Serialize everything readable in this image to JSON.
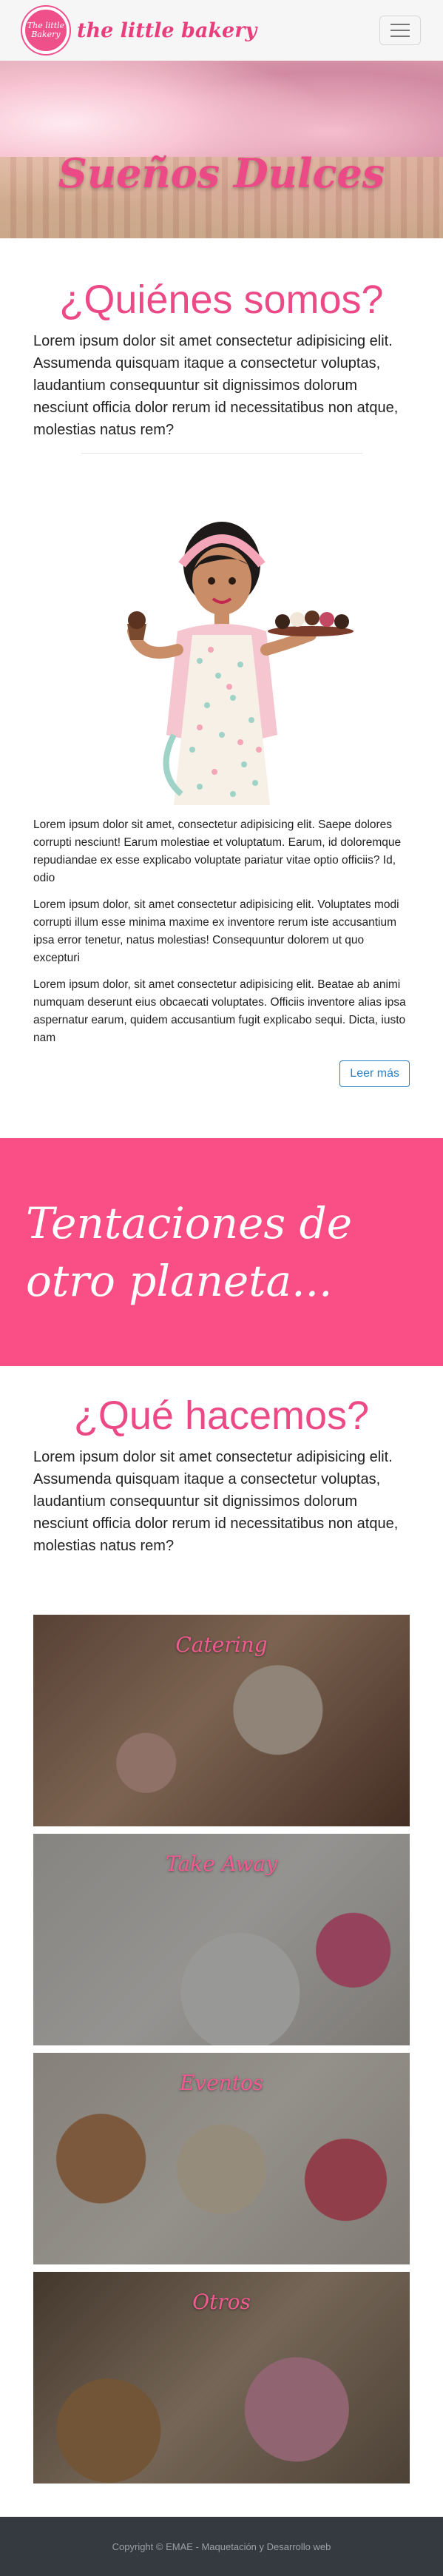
{
  "navbar": {
    "logo_text": "The little Bakery",
    "brand": "the little bakery"
  },
  "hero": {
    "title": "Sueños Dulces"
  },
  "about": {
    "title": "¿Quiénes somos?",
    "lead": "Lorem ipsum dolor sit amet consectetur adipisicing elit. Assumenda quisquam itaque a consectetur voluptas, laudantium consequuntur sit dignissimos dolorum nesciunt officia dolor rerum id necessitatibus non atque, molestias natus rem?",
    "paragraphs": [
      "Lorem ipsum dolor sit amet, consectetur adipisicing elit. Saepe dolores corrupti nesciunt! Earum molestiae et voluptatum. Earum, id doloremque repudiandae ex esse explicabo voluptate pariatur vitae optio officiis? Id, odio",
      "Lorem ipsum dolor, sit amet consectetur adipisicing elit. Voluptates modi corrupti illum esse minima maxime ex inventore rerum iste accusantium ipsa error tenetur, natus molestias! Consequuntur dolorem ut quo excepturi",
      "Lorem ipsum dolor, sit amet consectetur adipisicing elit. Beatae ab animi numquam deserunt eius obcaecati voluptates. Officiis inventore alias ipsa aspernatur earum, quidem accusantium fugit explicabo sequi. Dicta, iusto nam"
    ],
    "button_label": "Leer más"
  },
  "banner": {
    "text": "Tentaciones de otro planeta..."
  },
  "what": {
    "title": "¿Qué hacemos?",
    "lead": "Lorem ipsum dolor sit amet consectetur adipisicing elit. Assumenda quisquam itaque a consectetur voluptas, laudantium consequuntur sit dignissimos dolorum nesciunt officia dolor rerum id necessitatibus non atque, molestias natus rem?"
  },
  "services": [
    {
      "label": "Catering"
    },
    {
      "label": "Take Away"
    },
    {
      "label": "Eventos"
    },
    {
      "label": "Otros"
    }
  ],
  "footer": {
    "text": "Copyright © EMAE - Maquetación y Desarrollo web"
  },
  "colors": {
    "accent": "#ec4a86",
    "banner": "#fa4f86",
    "footer_bg": "#343a40",
    "button": "#2a7fc6"
  },
  "icons": {
    "menu": "hamburger-menu-icon"
  }
}
